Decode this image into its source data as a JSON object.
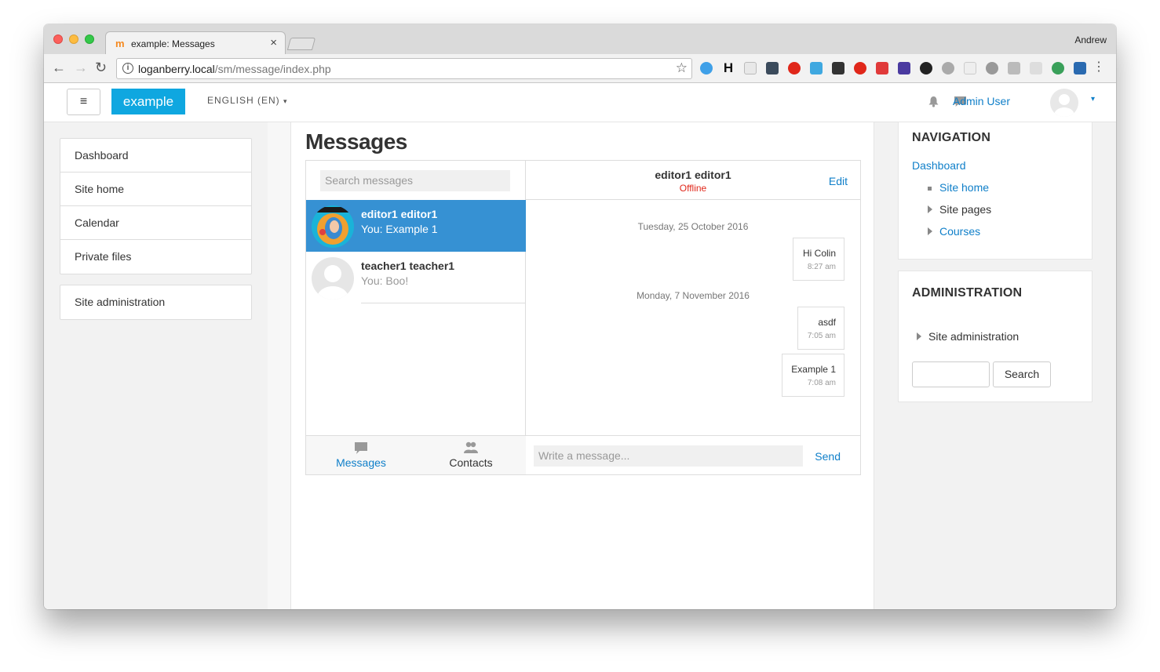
{
  "browser": {
    "tab_title": "example: Messages",
    "tab_close": "×",
    "profile_name": "Andrew",
    "url_host": "loganberry.local",
    "url_path": "/sm/message/index.php",
    "back_icon": "←",
    "forward_icon": "→",
    "reload_icon": "↻",
    "star_icon": "☆",
    "menu_icon": "⋮"
  },
  "navbar": {
    "hamburger": "≡",
    "brand": "example",
    "language": "ENGLISH (EN)",
    "language_caret": "▾",
    "user_name": "Admin User",
    "user_caret": "▾"
  },
  "left_nav": {
    "items": [
      "Dashboard",
      "Site home",
      "Calendar",
      "Private files"
    ],
    "admin_item": "Site administration"
  },
  "main": {
    "heading": "Messages",
    "search_placeholder": "Search messages",
    "conversations": [
      {
        "name": "editor1 editor1",
        "last": "You: Example 1",
        "active": true
      },
      {
        "name": "teacher1 teacher1",
        "last": "You: Boo!",
        "active": false
      }
    ],
    "footer_tabs": [
      {
        "label": "Messages",
        "active": true
      },
      {
        "label": "Contacts",
        "active": false
      }
    ],
    "conversation": {
      "name": "editor1 editor1",
      "status": "Offline",
      "edit_label": "Edit",
      "groups": [
        {
          "date": "Tuesday, 25 October 2016",
          "messages": [
            {
              "text": "Hi Colin",
              "time": "8:27 am"
            }
          ]
        },
        {
          "date": "Monday, 7 November 2016",
          "messages": [
            {
              "text": "asdf",
              "time": "7:05 am"
            },
            {
              "text": "Example 1",
              "time": "7:08 am"
            }
          ]
        }
      ],
      "compose_placeholder": "Write a message...",
      "send_label": "Send"
    }
  },
  "navigation_block": {
    "title": "NAVIGATION",
    "dashboard": "Dashboard",
    "site_home": "Site home",
    "site_pages": "Site pages",
    "courses": "Courses"
  },
  "administration_block": {
    "title": "ADMINISTRATION",
    "site_admin": "Site administration",
    "search_button": "Search"
  },
  "colors": {
    "brand": "#0fa7e0",
    "link": "#0f7fc9",
    "active_conversation": "#3691d3",
    "offline": "#e0271a"
  }
}
